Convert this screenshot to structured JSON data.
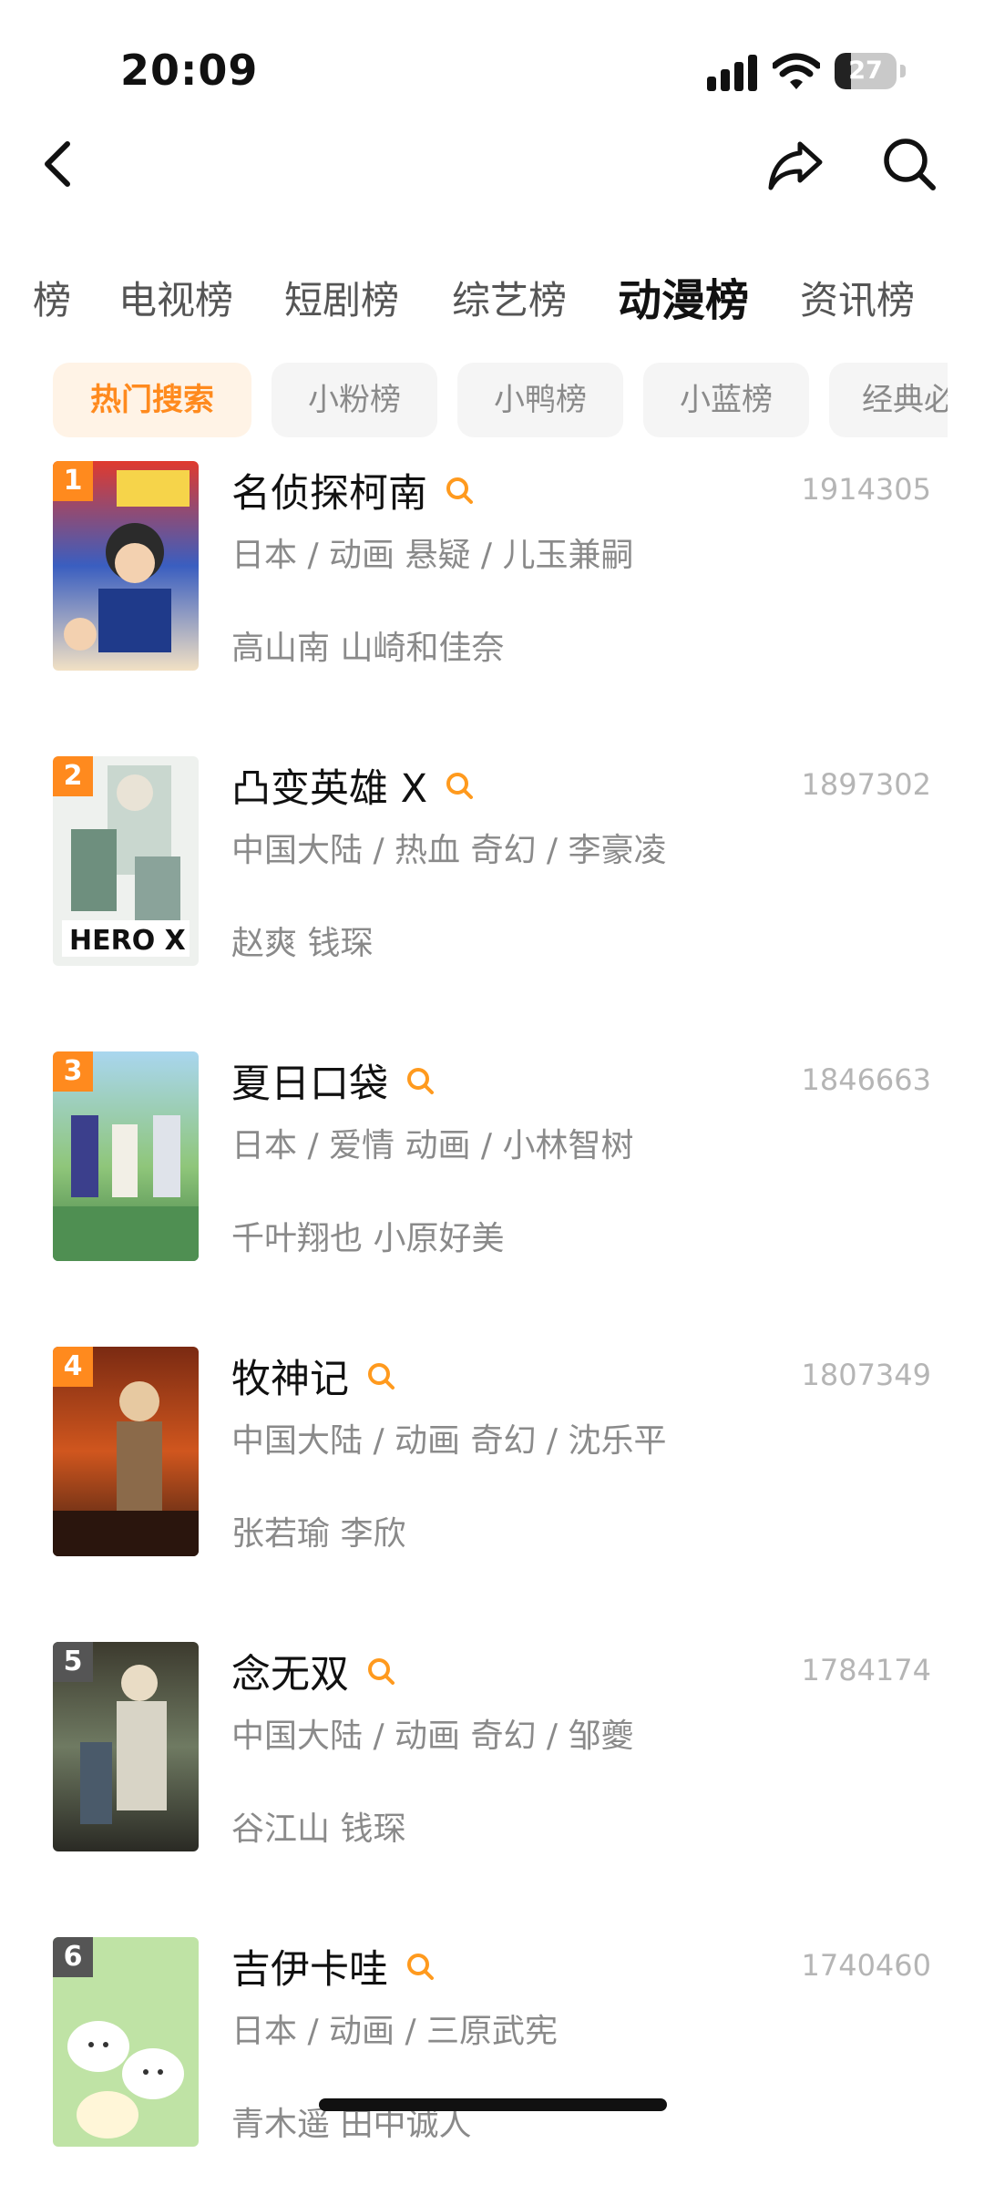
{
  "status_bar": {
    "time": "20:09",
    "battery": "27",
    "battery_level": 0.27
  },
  "nav": {
    "back_icon": "chevron-left-icon",
    "share_icon": "share-icon",
    "search_icon": "search-icon"
  },
  "category_tabs": [
    "榜",
    "电视榜",
    "短剧榜",
    "综艺榜",
    "动漫榜",
    "资讯榜"
  ],
  "active_category": "动漫榜",
  "chips": [
    "热门搜索",
    "小粉榜",
    "小鸭榜",
    "小蓝榜",
    "经典必"
  ],
  "active_chip": "热门搜索",
  "colors": {
    "accent": "#ff8a1e",
    "chip_active_bg": "#fff3e6",
    "rank_top": "#ff8a1e",
    "rank_other": "#555555"
  },
  "items": [
    {
      "rank": "1",
      "title": "名侦探柯南",
      "count": "1914305",
      "meta": "日本 / 动画 悬疑 / 儿玉兼嗣",
      "cast": "高山南 山崎和佳奈"
    },
    {
      "rank": "2",
      "title": "凸变英雄 X",
      "count": "1897302",
      "meta": "中国大陆 / 热血 奇幻 / 李豪凌",
      "cast": "赵爽 钱琛"
    },
    {
      "rank": "3",
      "title": "夏日口袋",
      "count": "1846663",
      "meta": "日本 / 爱情 动画 / 小林智树",
      "cast": "千叶翔也 小原好美"
    },
    {
      "rank": "4",
      "title": "牧神记",
      "count": "1807349",
      "meta": "中国大陆 / 动画 奇幻 / 沈乐平",
      "cast": "张若瑜 李欣"
    },
    {
      "rank": "5",
      "title": "念无双",
      "count": "1784174",
      "meta": "中国大陆 / 动画 奇幻 / 邹夔",
      "cast": "谷江山 钱琛"
    },
    {
      "rank": "6",
      "title": "吉伊卡哇",
      "count": "1740460",
      "meta": "日本 / 动画 / 三原武宪",
      "cast": "青木遥 田中诚人"
    }
  ]
}
